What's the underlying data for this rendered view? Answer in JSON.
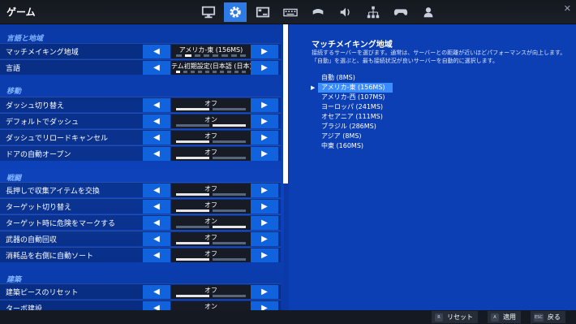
{
  "header": {
    "title": "ゲーム",
    "close": "✕",
    "tabs": [
      {
        "name": "video-tab",
        "icon": "monitor-icon"
      },
      {
        "name": "game-tab",
        "icon": "gear-icon",
        "active": true
      },
      {
        "name": "hud-tab",
        "icon": "hud-icon"
      },
      {
        "name": "keyboard-tab",
        "icon": "keyboard-icon"
      },
      {
        "name": "controller-tab",
        "icon": "controller-swap-icon"
      },
      {
        "name": "audio-tab",
        "icon": "speaker-icon"
      },
      {
        "name": "network-tab",
        "icon": "network-icon"
      },
      {
        "name": "gamepad-tab",
        "icon": "gamepad-icon"
      },
      {
        "name": "account-tab",
        "icon": "account-icon"
      }
    ]
  },
  "sections": {
    "region": "言語と地域",
    "movement": "移動",
    "combat": "戦闘",
    "building": "建築"
  },
  "rows": {
    "matchmaking": {
      "label": "マッチメイキング地域",
      "value": "アメリカ-東 (156MS)"
    },
    "language": {
      "label": "言語",
      "value": "テム初期設定(日本語 (日本))"
    },
    "sprint_toggle": {
      "label": "ダッシュ切り替え",
      "value": "オフ"
    },
    "sprint_default": {
      "label": "デフォルトでダッシュ",
      "value": "オン"
    },
    "sprint_cancel_reload": {
      "label": "ダッシュでリロードキャンセル",
      "value": "オフ"
    },
    "auto_open_doors": {
      "label": "ドアの自動オープン",
      "value": "オフ"
    },
    "hold_to_swap": {
      "label": "長押しで収集アイテムを交換",
      "value": "オフ"
    },
    "toggle_targeting": {
      "label": "ターゲット切り替え",
      "value": "オフ"
    },
    "mark_danger": {
      "label": "ターゲット時に危険をマークする",
      "value": "オン"
    },
    "auto_pickup": {
      "label": "武器の自動回収",
      "value": "オフ"
    },
    "auto_sort": {
      "label": "消耗品を右側に自動ソート",
      "value": "オフ"
    },
    "reset_build": {
      "label": "建築ピースのリセット",
      "value": "オフ"
    },
    "turbo_build": {
      "label": "ターボ建設",
      "value": "オン"
    }
  },
  "arrows": {
    "prev": "◀",
    "next": "▶"
  },
  "detail": {
    "title": "マッチメイキング地域",
    "description": "接続するサーバーを選びます。通常は、サーバーとの距離が近いほどパフォーマンスが向上します。「自動」を選ぶと、最も接続状況が良いサーバーを自動的に選択します。",
    "caret": "▶",
    "options": [
      "自動 (8MS)",
      "アメリカ-東 (156MS)",
      "アメリカ-西 (107MS)",
      "ヨーロッパ (241MS)",
      "オセアニア (111MS)",
      "ブラジル (286MS)",
      "アジア (8MS)",
      "中東 (160MS)"
    ],
    "selected_index": 1
  },
  "footer": {
    "reset": {
      "key": "R",
      "label": "リセット"
    },
    "apply": {
      "key": "A",
      "label": "適用"
    },
    "back": {
      "key": "ESC",
      "label": "戻る"
    }
  },
  "colors": {
    "accent": "#2f7be6",
    "panel": "#0b3aa8",
    "selection": "#3b8cff"
  }
}
